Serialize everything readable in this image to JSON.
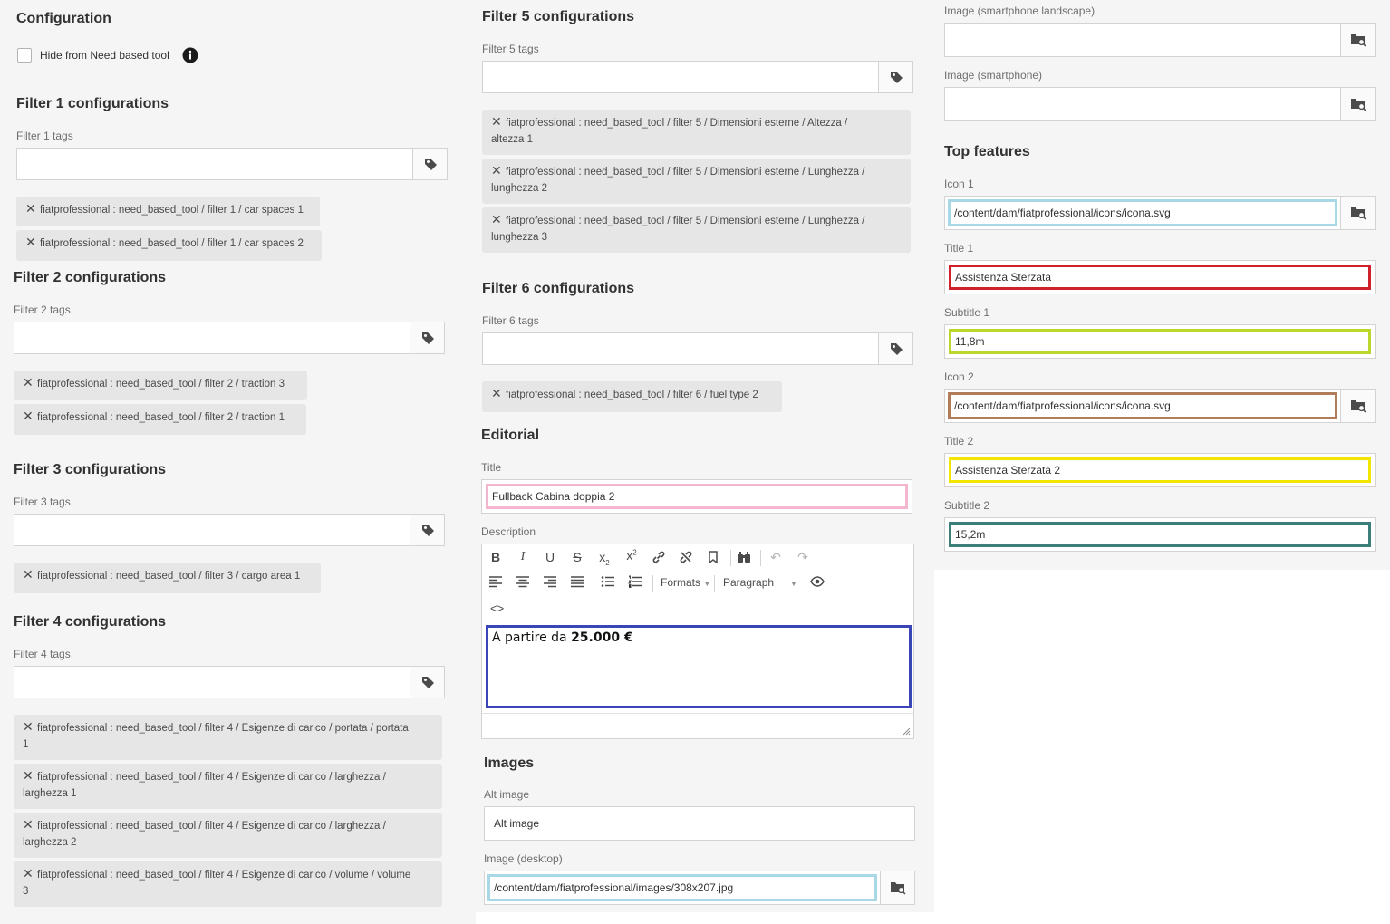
{
  "config": {
    "heading": "Configuration",
    "hide_label": "Hide from Need based tool"
  },
  "filters": [
    {
      "heading": "Filter 1 configurations",
      "label": "Filter 1 tags",
      "tags": [
        "fiatprofessional : need_based_tool / filter 1 / car spaces 1",
        "fiatprofessional : need_based_tool / filter 1 / car spaces 2"
      ]
    },
    {
      "heading": "Filter 2 configurations",
      "label": "Filter 2 tags",
      "tags": [
        "fiatprofessional : need_based_tool / filter 2 / traction 3",
        "fiatprofessional : need_based_tool / filter 2 / traction 1"
      ]
    },
    {
      "heading": "Filter 3 configurations",
      "label": "Filter 3 tags",
      "tags": [
        "fiatprofessional : need_based_tool / filter 3 / cargo area 1"
      ]
    },
    {
      "heading": "Filter 4 configurations",
      "label": "Filter 4 tags",
      "tags": [
        {
          "line1": "fiatprofessional : need_based_tool / filter 4 / Esigenze di carico / portata / portata",
          "line2": "1"
        },
        {
          "line1": "fiatprofessional : need_based_tool / filter 4 / Esigenze di carico / larghezza /",
          "line2": "larghezza 1"
        },
        {
          "line1": "fiatprofessional : need_based_tool / filter 4 / Esigenze di carico / larghezza /",
          "line2": "larghezza 2"
        },
        {
          "line1": "fiatprofessional : need_based_tool / filter 4 / Esigenze di carico / volume / volume",
          "line2": "3"
        }
      ]
    },
    {
      "heading": "Filter 5 configurations",
      "label": "Filter 5 tags",
      "tags": [
        {
          "line1": "fiatprofessional : need_based_tool / filter 5 / Dimensioni esterne / Altezza /",
          "line2": "altezza 1"
        },
        {
          "line1": "fiatprofessional : need_based_tool / filter 5 / Dimensioni esterne / Lunghezza /",
          "line2": "lunghezza 2"
        },
        {
          "line1": "fiatprofessional : need_based_tool / filter 5 / Dimensioni esterne / Lunghezza /",
          "line2": "lunghezza 3"
        }
      ]
    },
    {
      "heading": "Filter 6 configurations",
      "label": "Filter 6 tags",
      "tags": [
        "fiatprofessional : need_based_tool / filter 6 / fuel type 2"
      ]
    }
  ],
  "editorial": {
    "heading": "Editorial",
    "title_label": "Title",
    "title_value": "Fullback Cabina doppia 2",
    "description_label": "Description",
    "formats_label": "Formats",
    "paragraph_label": "Paragraph",
    "code_label": "<>",
    "desc_text": "A partire da ",
    "desc_bold": "25.000 €"
  },
  "images": {
    "heading": "Images",
    "alt_label": "Alt image",
    "alt_value": "Alt image",
    "desktop_label": "Image (desktop)",
    "desktop_value": "/content/dam/fiatprofessional/images/308x207.jpg",
    "landscape_label": "Image (smartphone landscape)",
    "smartphone_label": "Image (smartphone)"
  },
  "top_features": {
    "heading": "Top features",
    "icon1_label": "Icon 1",
    "icon1_value": "/content/dam/fiatprofessional/icons/icona.svg",
    "title1_label": "Title 1",
    "title1_value": "Assistenza Sterzata",
    "subtitle1_label": "Subtitle 1",
    "subtitle1_value": "11,8m",
    "icon2_label": "Icon 2",
    "icon2_value": "/content/dam/fiatprofessional/icons/icona.svg",
    "title2_label": "Title 2",
    "title2_value": "Assistenza Sterzata 2",
    "subtitle2_label": "Subtitle 2",
    "subtitle2_value": "15,2m"
  },
  "colors": {
    "highlight_cyan": "#a8d8e6",
    "highlight_pink": "#f4b6cf",
    "highlight_navy": "#3a46b8",
    "highlight_red": "#d0202a",
    "highlight_lime": "#bcd62e",
    "highlight_brown": "#b07c5a",
    "highlight_yellow": "#f2e600",
    "highlight_teal": "#3c7f7a"
  }
}
